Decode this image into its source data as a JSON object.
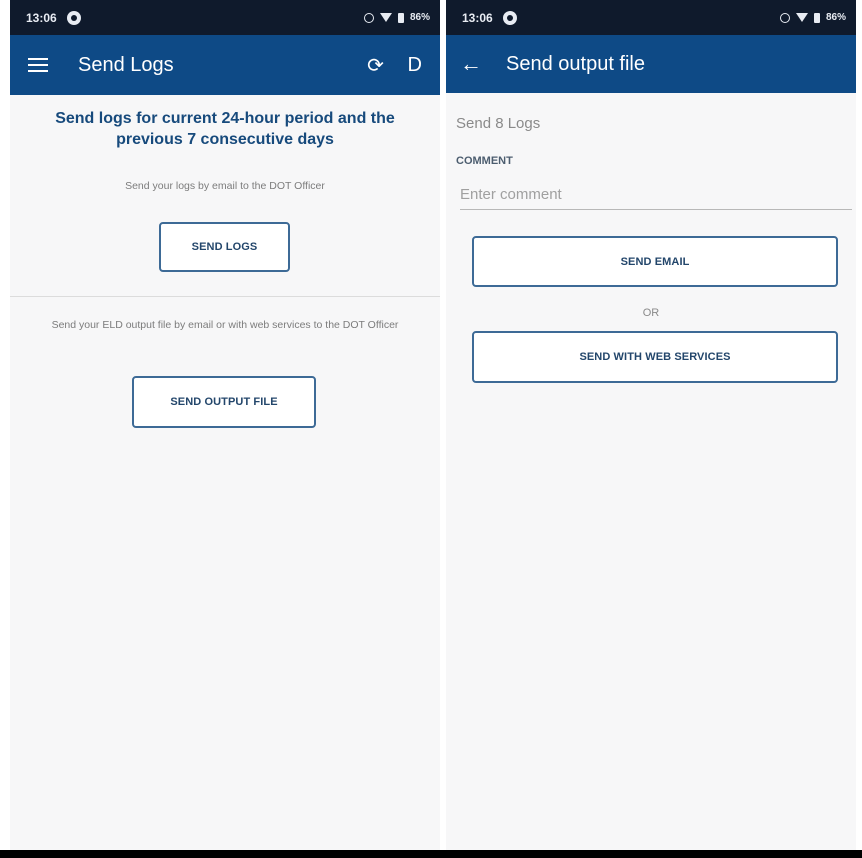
{
  "left": {
    "status": {
      "time": "13:06",
      "battery": "86%"
    },
    "app_bar": {
      "title": "Send Logs",
      "driver_initial": "D",
      "menu_icon": "hamburger-menu-icon",
      "sync_icon": "sync-icon"
    },
    "headline": "Send logs for current 24-hour period and the previous 7 consecutive days",
    "email_hint": "Send your logs by email to the DOT Officer",
    "send_logs_label": "SEND LOGS",
    "output_hint": "Send your ELD output file by email or with web services to the DOT Officer",
    "send_output_label": "SEND OUTPUT FILE"
  },
  "right": {
    "status": {
      "time": "13:06",
      "battery": "86%"
    },
    "app_bar": {
      "title": "Send output file",
      "back_icon": "back-arrow-icon"
    },
    "send_count": "Send 8 Logs",
    "comment_label": "COMMENT",
    "comment_placeholder": "Enter comment",
    "comment_value": "",
    "send_email_label": "SEND EMAIL",
    "or_text": "OR",
    "send_web_label": "SEND WITH WEB SERVICES"
  },
  "colors": {
    "app_bar": "#0e4a86",
    "status_bar": "#0f1a2c",
    "headline": "#174a7c",
    "button_border": "#3d6a96",
    "background": "#f7f7f8"
  }
}
